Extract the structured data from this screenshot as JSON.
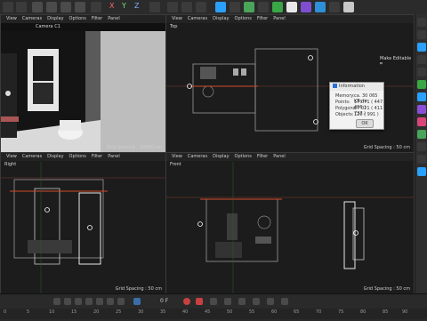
{
  "toolbar": {
    "axis_labels": [
      "X",
      "Y",
      "Z"
    ],
    "accent": "#2aa0ff"
  },
  "viewports": {
    "perspective": {
      "camera_label": "Camera C1",
      "grid_spacing": "Grid Spacing : 10000 cm"
    },
    "top": {
      "name": "Top",
      "menu": [
        "View",
        "Cameras",
        "Display",
        "Options",
        "Filter",
        "Panel"
      ],
      "make_editable": "Make Editable  ⌗",
      "grid_spacing": "Grid Spacing : 50 cm"
    },
    "right": {
      "name": "Right",
      "menu": [
        "View",
        "Cameras",
        "Display",
        "Options",
        "Filter",
        "Panel"
      ],
      "grid_spacing": "Grid Spacing : 50 cm"
    },
    "front": {
      "name": "Front",
      "menu": [
        "View",
        "Cameras",
        "Display",
        "Options",
        "Filter",
        "Panel"
      ],
      "grid_spacing": "Grid Spacing : 50 cm"
    },
    "perspective_menu": [
      "View",
      "Cameras",
      "Display",
      "Options",
      "Filter",
      "Panel"
    ]
  },
  "info_dialog": {
    "title": "Information",
    "rows": [
      {
        "label": "Memory:",
        "value": "ca. 30 065 KByte"
      },
      {
        "label": "Points:",
        "value": "17 071 ( 447 406 )"
      },
      {
        "label": "Polygons:",
        "value": "17 021 ( 411 737 )"
      },
      {
        "label": "Objects:",
        "value": "120 ( 991 )"
      }
    ],
    "ok_label": "OK"
  },
  "timeline": {
    "ticks": [
      "0",
      "5",
      "10",
      "15",
      "20",
      "25",
      "30",
      "35",
      "40",
      "45",
      "50",
      "55",
      "60",
      "65",
      "70",
      "75",
      "80",
      "85",
      "90"
    ],
    "current_frame": "0 F",
    "end_frame": "90 F"
  }
}
